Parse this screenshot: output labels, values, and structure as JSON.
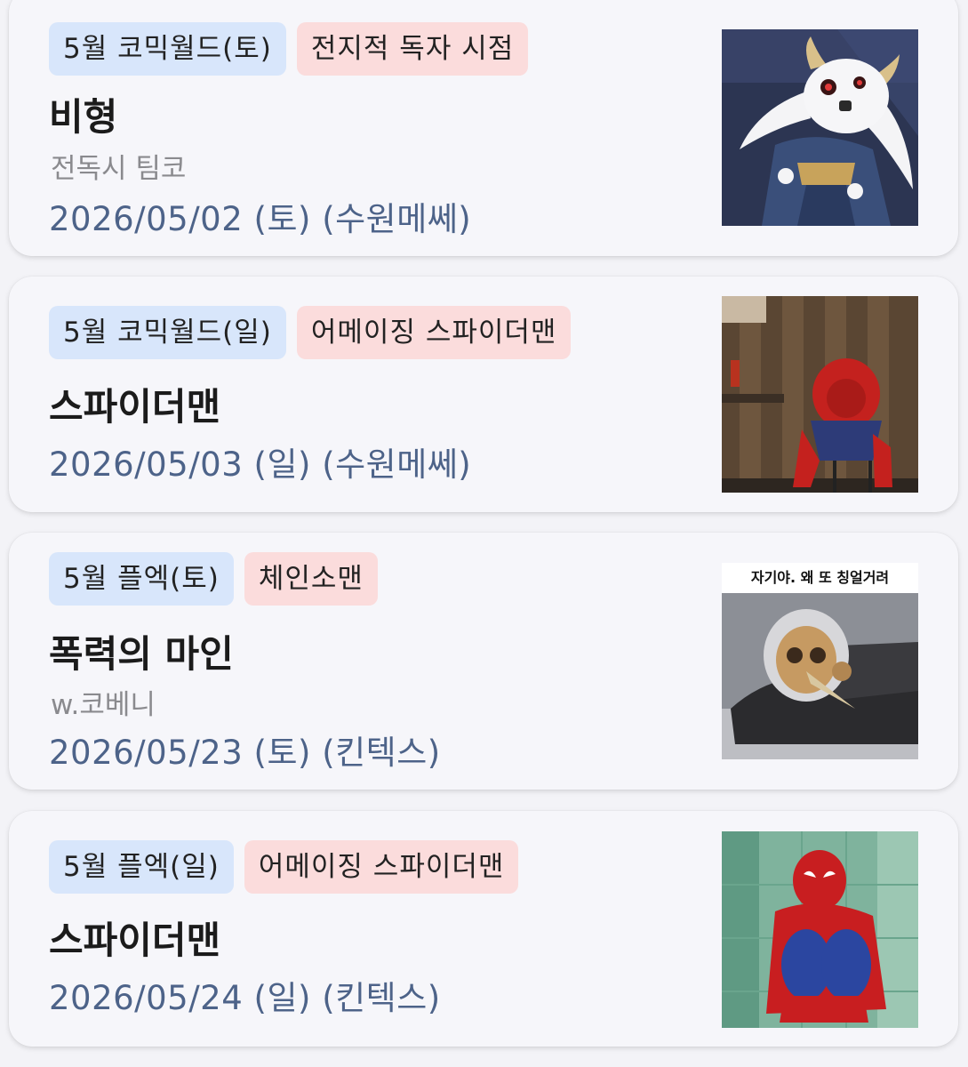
{
  "events": [
    {
      "event_tag": "5월 코믹월드(토)",
      "work_tag": "전지적 독자 시점",
      "title": "비형",
      "subtitle": "전독시 팀코",
      "date": "2026/05/02 (토) (수원메쎄)",
      "image_icon": "horned-mascot-image"
    },
    {
      "event_tag": "5월 코믹월드(일)",
      "work_tag": "어메이징 스파이더맨",
      "title": "스파이더맨",
      "date": "2026/05/03 (일) (수원메쎄)",
      "image_icon": "spiderman-sitting-image"
    },
    {
      "event_tag": "5월 플엑(토)",
      "work_tag": "체인소맨",
      "title": "폭력의 마인",
      "subtitle": "w.코베니",
      "date": "2026/05/23 (토) (킨텍스)",
      "image_icon": "plague-mask-meme-image",
      "image_caption": "자기야. 왜 또 칭얼거려"
    },
    {
      "event_tag": "5월 플엑(일)",
      "work_tag": "어메이징 스파이더맨",
      "title": "스파이더맨",
      "date": "2026/05/24 (일) (킨텍스)",
      "image_icon": "spiderman-crouching-image"
    }
  ],
  "colors": {
    "event_tag_bg": "#d8e6fb",
    "work_tag_bg": "#fbdcdc",
    "date_text": "#4d6389",
    "subtitle_text": "#8a8a8e",
    "card_bg": "#f6f6fa"
  }
}
